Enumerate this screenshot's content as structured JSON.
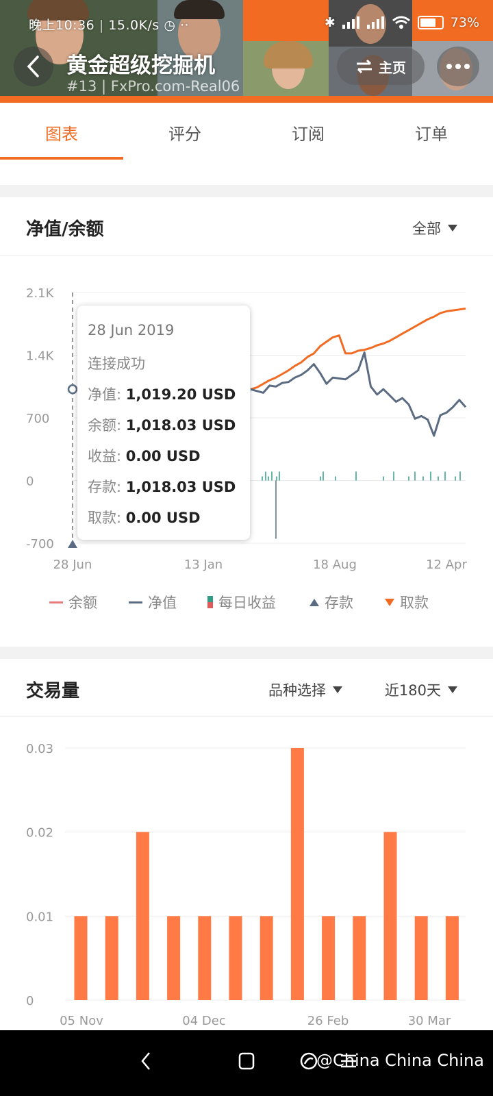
{
  "status_bar": {
    "time": "晚上10:36",
    "speed": "15.0K/s",
    "battery": "73%"
  },
  "header": {
    "title": "黄金超级挖掘机",
    "subtitle": "#13 | FxPro.com-Real06",
    "home_label": "主页"
  },
  "tabs": [
    {
      "label": "图表"
    },
    {
      "label": "评分"
    },
    {
      "label": "订阅"
    },
    {
      "label": "订单"
    }
  ],
  "equity_card": {
    "title": "净值/余额",
    "range_label": "全部"
  },
  "tooltip": {
    "date": "28 Jun 2019",
    "status": "连接成功",
    "rows": [
      {
        "label": "净值:",
        "value": "1,019.20 USD"
      },
      {
        "label": "余额:",
        "value": "1,018.03 USD"
      },
      {
        "label": "收益:",
        "value": "0.00 USD"
      },
      {
        "label": "存款:",
        "value": "1,018.03 USD"
      },
      {
        "label": "取款:",
        "value": "0.00 USD"
      }
    ]
  },
  "legend": [
    {
      "label": "余额",
      "color": "#e87b7b"
    },
    {
      "label": "净值",
      "color": "#5b6c82"
    },
    {
      "label": "每日收益",
      "color": "#2f9d86"
    },
    {
      "label": "存款",
      "color": "#5b6c82"
    },
    {
      "label": "取款",
      "color": "#f26b22"
    }
  ],
  "volume_card": {
    "title": "交易量",
    "symbol_label": "品种选择",
    "period_label": "近180天"
  },
  "chart_data": [
    {
      "type": "line",
      "x_ticks": [
        "28 Jun",
        "13 Jan",
        "18 Aug",
        "12 Apr"
      ],
      "y_ticks": [
        "2.1K",
        "1.4K",
        "700",
        "0",
        "-700"
      ],
      "ylim": [
        -700,
        2100
      ],
      "series": [
        {
          "name": "余额",
          "color": "#f26b22",
          "values": [
            1018,
            1040,
            1080,
            1120,
            1150,
            1190,
            1230,
            1280,
            1320,
            1380,
            1420,
            1500,
            1550,
            1600,
            1620,
            1420,
            1420,
            1450,
            1460,
            1480,
            1510,
            1530,
            1560,
            1600,
            1640,
            1680,
            1720,
            1760,
            1800,
            1830,
            1870,
            1890,
            1900,
            1910,
            1920
          ]
        },
        {
          "name": "净值",
          "color": "#5b6c82",
          "values": [
            1019,
            1000,
            980,
            1060,
            1050,
            1090,
            1100,
            1150,
            1180,
            1230,
            1300,
            1200,
            1080,
            1150,
            1140,
            1130,
            1180,
            1230,
            1430,
            1050,
            960,
            1020,
            950,
            880,
            920,
            850,
            690,
            720,
            680,
            500,
            730,
            760,
            820,
            900,
            820
          ]
        },
        {
          "name": "每日收益",
          "color": "#2f9d86",
          "type": "bar"
        }
      ],
      "tooltip_index": 0
    },
    {
      "type": "bar",
      "x_ticks": [
        "05 Nov",
        "04 Dec",
        "26 Feb",
        "30 Mar"
      ],
      "y_ticks": [
        "0.03",
        "0.02",
        "0.01",
        "0"
      ],
      "ylim": [
        0,
        0.03
      ],
      "series": [
        {
          "name": "交易量",
          "color": "#ff7a45",
          "values": [
            0.01,
            0.01,
            0.02,
            0.01,
            0.01,
            0.01,
            0.01,
            0.03,
            0.01,
            0.01,
            0.02,
            0.01,
            0.01
          ]
        }
      ]
    }
  ],
  "system_nav": {
    "watermark": "@China China China"
  }
}
